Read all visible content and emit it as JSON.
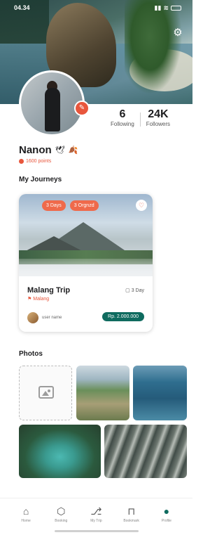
{
  "status_bar": {
    "time": "04.34"
  },
  "profile": {
    "name": "Nanon",
    "points": "1600 points",
    "stats": [
      {
        "value": "6",
        "label": "Following"
      },
      {
        "value": "24K",
        "label": "Followers"
      }
    ]
  },
  "journeys": {
    "title": "My Journeys",
    "card": {
      "chips": [
        "3 Days",
        "3 Orgnzd"
      ],
      "title": "Malang Trip",
      "location": "Malang",
      "days": "3 Day",
      "owner": "user name",
      "price": "Rp. 2.000.000"
    }
  },
  "photos": {
    "title": "Photos"
  },
  "nav": [
    {
      "icon": "home-icon",
      "label": "Home",
      "glyph": "⌂"
    },
    {
      "icon": "booking-icon",
      "label": "Booking",
      "glyph": "⬡"
    },
    {
      "icon": "trip-icon",
      "label": "My Trip",
      "glyph": "⎇"
    },
    {
      "icon": "bookmark-icon",
      "label": "Bookmark",
      "glyph": "⊓"
    },
    {
      "icon": "profile-icon",
      "label": "Profile",
      "glyph": "●"
    }
  ],
  "colors": {
    "accent": "#e8563c",
    "primary": "#0f6b5f"
  }
}
